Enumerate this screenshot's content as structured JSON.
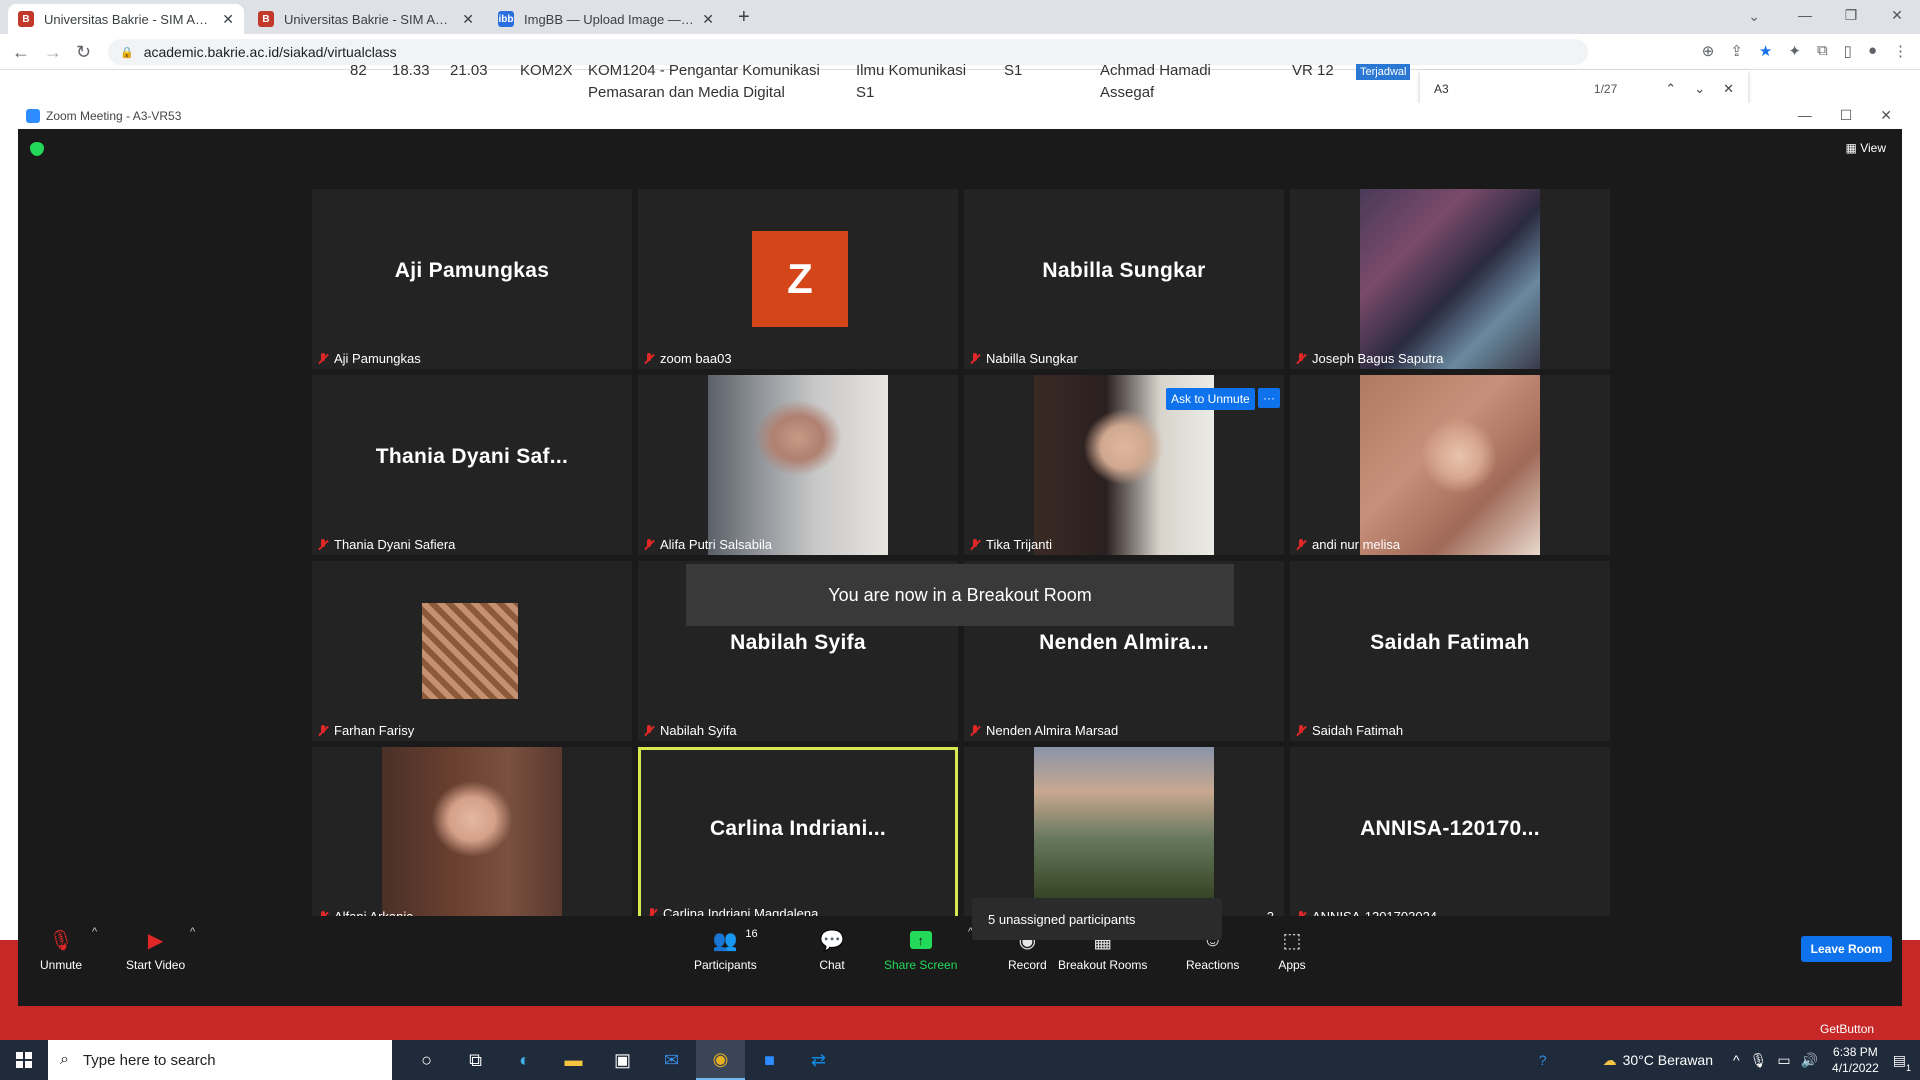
{
  "browser": {
    "tabs": [
      {
        "title": "Universitas Bakrie - SIM Akadem",
        "active": true,
        "favicon": "bakrie-icon"
      },
      {
        "title": "Universitas Bakrie - SIM Akadem",
        "active": false,
        "favicon": "bakrie-icon"
      },
      {
        "title": "ImgBB — Upload Image — Free",
        "active": false,
        "favicon": "imgbb-icon"
      }
    ],
    "url": "academic.bakrie.ac.id/siakad/virtualclass"
  },
  "page_behind": {
    "row": [
      "82",
      "18.33",
      "21.03",
      "KOM2X",
      "KOM1204 - Pengantar Komunikasi",
      "Pemasaran dan Media Digital",
      "Ilmu Komunikasi",
      "S1",
      "S1",
      "Achmad Hamadi",
      "Assegaf",
      "VR 12",
      "Terjadwal"
    ]
  },
  "find_bar": {
    "query": "A3",
    "count": "1/27"
  },
  "zoom": {
    "window_title": "Zoom Meeting - A3-VR53",
    "view_label": "View",
    "participants": [
      {
        "display": "Aji Pamungkas",
        "name": "Aji Pamungkas",
        "type": "text"
      },
      {
        "display": "Z",
        "name": "zoom baa03",
        "type": "avatar"
      },
      {
        "display": "Nabilla Sungkar",
        "name": "Nabilla Sungkar",
        "type": "text"
      },
      {
        "display": "",
        "name": "Joseph Bagus Saputra",
        "type": "photo"
      },
      {
        "display": "Thania  Dyani  Saf...",
        "name": "Thania Dyani Safiera",
        "type": "text"
      },
      {
        "display": "",
        "name": "Alifa Putri Salsabila",
        "type": "photo"
      },
      {
        "display": "",
        "name": "Tika Trijanti",
        "type": "photo"
      },
      {
        "display": "",
        "name": "andi nur melisa",
        "type": "photo"
      },
      {
        "display": "",
        "name": "Farhan Farisy",
        "type": "photo"
      },
      {
        "display": "Nabilah Syifa",
        "name": "Nabilah Syifa",
        "type": "text"
      },
      {
        "display": "Nenden  Almira...",
        "name": "Nenden Almira Marsad",
        "type": "text"
      },
      {
        "display": "Saidah Fatimah",
        "name": "Saidah Fatimah",
        "type": "text"
      },
      {
        "display": "",
        "name": "Alfani Arkania",
        "type": "photo"
      },
      {
        "display": "Carlina  Indriani...",
        "name": "Carlina Indriani Magdalena",
        "type": "text"
      },
      {
        "display": "",
        "name": "2",
        "type": "photo"
      },
      {
        "display": "ANNISA-120170...",
        "name": "ANNISA-1201703024",
        "type": "text"
      }
    ],
    "ask_to_unmute": "Ask to Unmute",
    "more_label": "···",
    "toast": "You are now in a Breakout Room",
    "unassigned": "5 unassigned participants",
    "toolbar": {
      "unmute": "Unmute",
      "start_video": "Start Video",
      "participants": "Participants",
      "participants_count": "16",
      "chat": "Chat",
      "share_screen": "Share Screen",
      "record": "Record",
      "breakout_rooms": "Breakout Rooms",
      "breakout_badge": "5",
      "reactions": "Reactions",
      "apps": "Apps",
      "leave_room": "Leave Room"
    }
  },
  "getbutton": "GetButton",
  "taskbar": {
    "search_placeholder": "Type here to search",
    "weather": "30°C  Berawan",
    "time": "6:38 PM",
    "date": "4/1/2022",
    "notifications": "1"
  },
  "colors": {
    "zoom_blue": "#0e72ed",
    "share_green": "#23d959",
    "mute_red": "#e02828",
    "active_speaker": "#d8e94e"
  }
}
